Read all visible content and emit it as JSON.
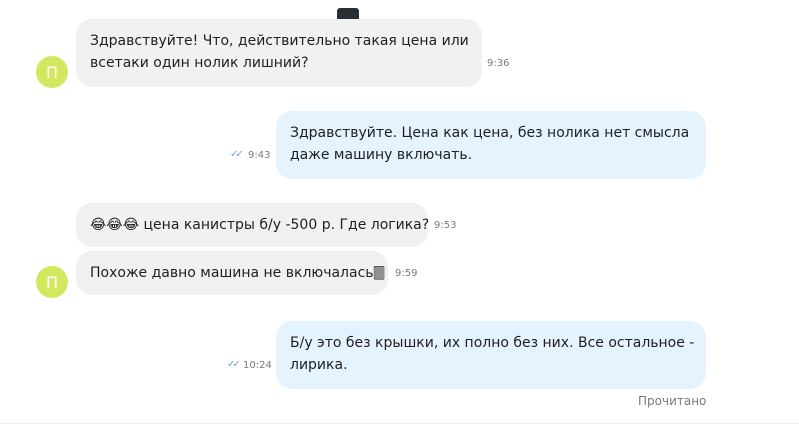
{
  "conversation": {
    "avatar_letter": "П",
    "messages": [
      {
        "direction": "in",
        "lines": [
          "Здравствуйте! Что, действительно такая цена или",
          "всетаки один нолик лишний?"
        ],
        "time": "9:36"
      },
      {
        "direction": "out",
        "lines": [
          "Здравствуйте. Цена как цена, без нолика нет смысла",
          "даже машину включать."
        ],
        "time": "9:43",
        "read_icon": "double-check-icon"
      },
      {
        "direction": "in",
        "lines": [
          "😂😂😂 цена канистры б/у -500 р. Где логика?"
        ],
        "time": "9:53"
      },
      {
        "direction": "in",
        "lines": [
          "Похоже давно машина не включалась🀫"
        ],
        "time": "9:59"
      },
      {
        "direction": "out",
        "lines": [
          "Б/у это без крышки, их полно без них. Все остальное -",
          "лирика."
        ],
        "time": "10:24",
        "read_icon": "double-check-icon"
      }
    ],
    "read_status": "Прочитано"
  },
  "colors": {
    "incoming_bubble": "#f1f1f1",
    "outgoing_bubble": "#e5f3ff",
    "avatar": "#d3e85e",
    "read_check": "#6fa4d8"
  }
}
